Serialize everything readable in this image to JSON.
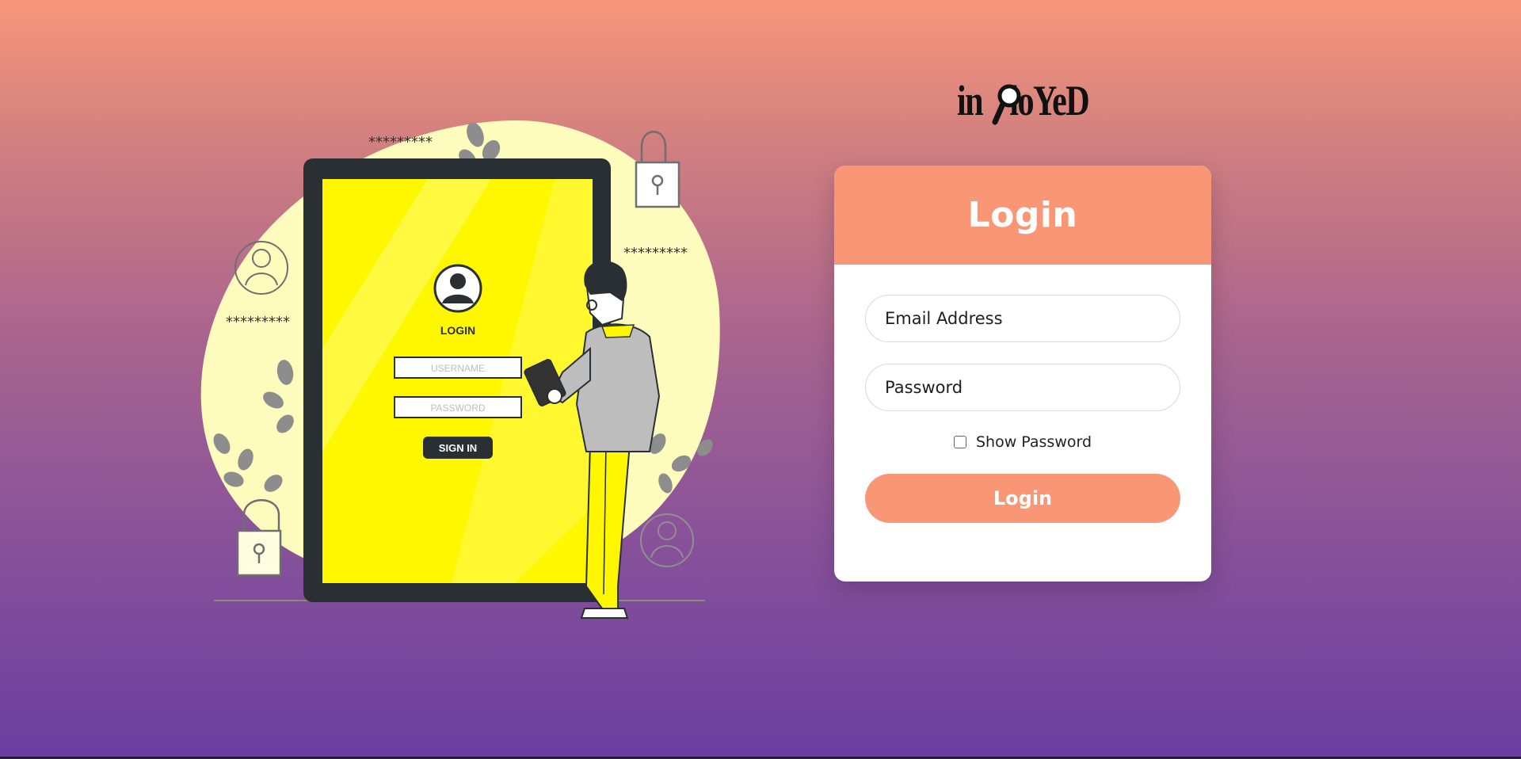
{
  "brand": {
    "logo_left": "in",
    "logo_right": "loYeD"
  },
  "illustration": {
    "stars_top": "*********",
    "stars_right": "*********",
    "stars_left": "*********",
    "screen_title": "LOGIN",
    "username_placeholder": "USERNAME",
    "password_placeholder": "PASSWORD",
    "sign_in": "SIGN IN"
  },
  "login": {
    "title": "Login",
    "email_placeholder": "Email Address",
    "password_placeholder": "Password",
    "show_password_label": "Show Password",
    "show_password_checked": false,
    "submit_label": "Login"
  },
  "colors": {
    "accent": "#f99676",
    "blob": "#fefcbc",
    "screen_yellow": "#fff700"
  }
}
